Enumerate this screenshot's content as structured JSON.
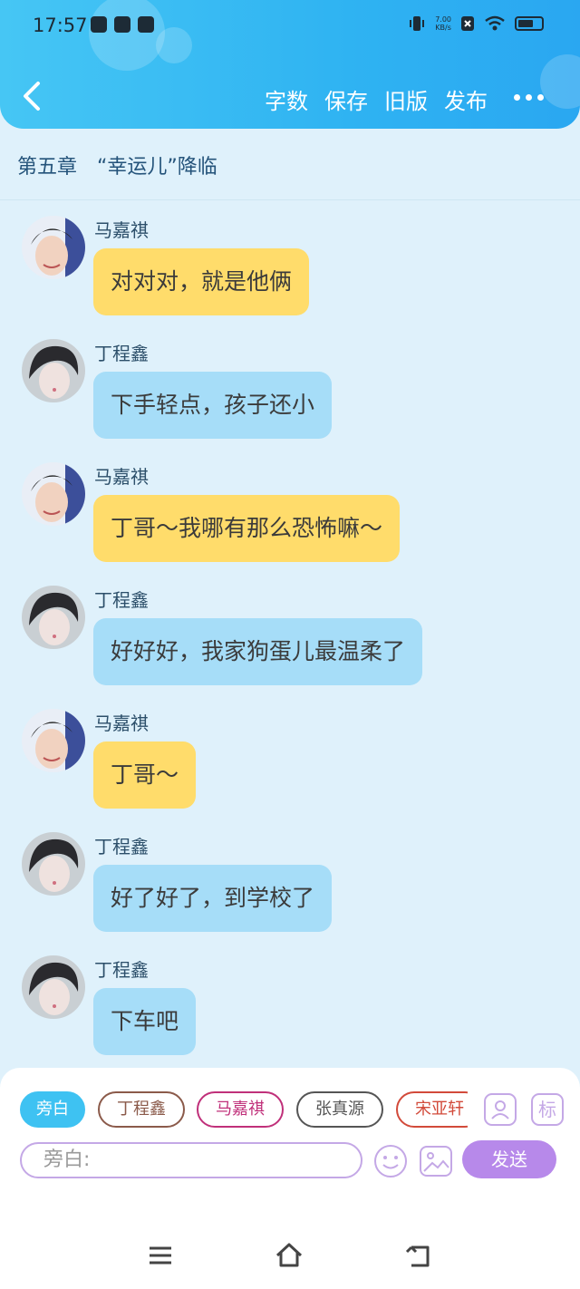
{
  "status": {
    "time": "17:57",
    "speed_value": "7.00",
    "speed_unit": "KB/s"
  },
  "header": {
    "menu": [
      "字数",
      "保存",
      "旧版",
      "发布"
    ]
  },
  "chapter": "第五章　“幸运儿”降临",
  "messages": [
    {
      "speaker": "马嘉祺",
      "text": "对对对，就是他俩",
      "color": "yellow"
    },
    {
      "speaker": "丁程鑫",
      "text": "下手轻点，孩子还小",
      "color": "blue"
    },
    {
      "speaker": "马嘉祺",
      "text": "丁哥～我哪有那么恐怖嘛～",
      "color": "yellow"
    },
    {
      "speaker": "丁程鑫",
      "text": "好好好，我家狗蛋儿最温柔了",
      "color": "blue"
    },
    {
      "speaker": "马嘉祺",
      "text": "丁哥～",
      "color": "yellow"
    },
    {
      "speaker": "丁程鑫",
      "text": "好了好了，到学校了",
      "color": "blue"
    },
    {
      "speaker": "丁程鑫",
      "text": "下车吧",
      "color": "blue"
    }
  ],
  "input": {
    "roles": [
      "旁白",
      "丁程鑫",
      "马嘉祺",
      "张真源",
      "宋亚轩"
    ],
    "role_colors": [
      "#3ec2f2",
      "#8b5a4a",
      "#c0307a",
      "#555555",
      "#d24a3a"
    ],
    "tag_label": "标",
    "placeholder": "旁白:",
    "send_label": "发送"
  },
  "icons": {
    "back": "chevron-left-icon",
    "more": "more-dots-icon",
    "role_manage": "person-card-icon",
    "emoji": "emoji-icon",
    "image": "image-icon",
    "nav": [
      "menu-icon",
      "home-icon",
      "back-icon"
    ]
  },
  "colors": {
    "header": "#2fb3f2",
    "yellow_bubble": "#ffdc6b",
    "blue_bubble": "#a6ddf8",
    "send": "#b789ea"
  }
}
